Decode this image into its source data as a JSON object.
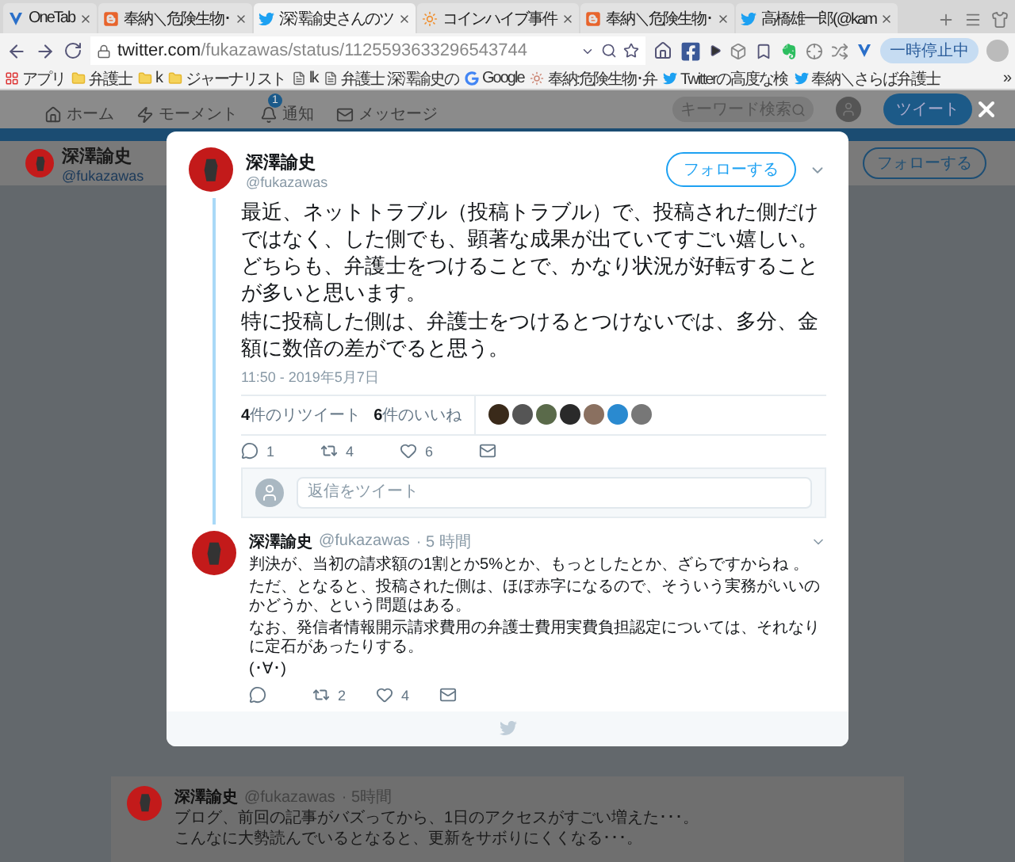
{
  "browser": {
    "tabs": [
      {
        "kind": "onetab",
        "title": "OneTab",
        "selected": false
      },
      {
        "kind": "blogger",
        "title": "奉納＼危険生物･",
        "selected": false
      },
      {
        "kind": "twitter",
        "title": "深澤諭史さんのツ",
        "selected": true
      },
      {
        "kind": "coin",
        "title": "コインハイブ事件",
        "selected": false
      },
      {
        "kind": "blogger",
        "title": "奉納＼危険生物･",
        "selected": false
      },
      {
        "kind": "twitter",
        "title": "高橋雄一郎(@kam",
        "selected": false
      }
    ],
    "address": {
      "host": "twitter.com",
      "path": "/fukazawas/status/1125593633296543744"
    },
    "paused_label": "一時停止中",
    "bookmarks": [
      {
        "kind": "apps",
        "label": "アプリ"
      },
      {
        "kind": "folder",
        "label": "弁護士"
      },
      {
        "kind": "folder",
        "label": "k"
      },
      {
        "kind": "folder",
        "label": "ジャーナリスト"
      },
      {
        "kind": "page",
        "label": "lk"
      },
      {
        "kind": "page",
        "label": "弁護士 深澤諭史の"
      },
      {
        "kind": "google",
        "label": "Google"
      },
      {
        "kind": "blog",
        "label": "奉納:危険生物･弁"
      },
      {
        "kind": "twitter",
        "label": "Twitterの高度な検"
      },
      {
        "kind": "twitter",
        "label": "奉納＼さらば弁護士"
      }
    ],
    "bookmarks_more": "»"
  },
  "twitter_nav": {
    "items": [
      {
        "kind": "home",
        "label": "ホーム"
      },
      {
        "kind": "moment",
        "label": "モーメント"
      },
      {
        "kind": "bell",
        "label": "通知",
        "badge": "1"
      },
      {
        "kind": "mail",
        "label": "メッセージ"
      }
    ],
    "search_placeholder": "キーワード検索",
    "tweet_button": "ツイート"
  },
  "profile_bar": {
    "name": "深澤諭史",
    "handle": "@fukazawas",
    "follow_button": "フォローする"
  },
  "modal": {
    "author": {
      "name": "深澤諭史",
      "handle": "@fukazawas"
    },
    "follow_button": "フォローする",
    "paragraphs": [
      "最近、ネットトラブル（投稿トラブル）で、投稿された側だけではなく、した側でも、顕著な成果が出ていてすごい嬉しい。",
      "どちらも、弁護士をつけることで、かなり状況が好転することが多いと思います。",
      "特に投稿した側は、弁護士をつけるとつけないでは、多分、金額に数倍の差がでると思う。"
    ],
    "timestamp": "11:50 - 2019年5月7日",
    "retweets": "**4**件のリツイート",
    "likes": "**6**件のいいね",
    "actions": [
      {
        "kind": "reply",
        "count": "1"
      },
      {
        "kind": "retweet",
        "count": "4"
      },
      {
        "kind": "like",
        "count": "6"
      },
      {
        "kind": "message"
      }
    ],
    "reply_placeholder": "返信をツイート",
    "replies": [
      {
        "name": "深澤諭史",
        "handle": "@fukazawas",
        "time": "· 5 時間",
        "paragraphs": [
          "判決が、当初の請求額の1割とか5%とか、もっとしたとか、ざらですからね 。",
          "ただ、となると、投稿された側は、ほぼ赤字になるので、そういう実務がいいのかどうか、という問題はある。",
          "なお、発信者情報開示請求費用の弁護士費用実費負担認定については、それなりに定石があったりする。",
          "(･∀･)"
        ],
        "actions": [
          {
            "kind": "reply"
          },
          {
            "kind": "retweet",
            "count": "2"
          },
          {
            "kind": "like",
            "count": "4"
          },
          {
            "kind": "message"
          }
        ]
      }
    ]
  },
  "background_tweet": {
    "name": "深澤諭史",
    "handle": "@fukazawas",
    "time": "· 5時間",
    "paragraphs": [
      "ブログ、前回の記事がバズってから、1日のアクセスがすごい増えた･･･。",
      "こんなに大勢読んでいるとなると、更新をサボりにくくなる･･･。"
    ]
  }
}
